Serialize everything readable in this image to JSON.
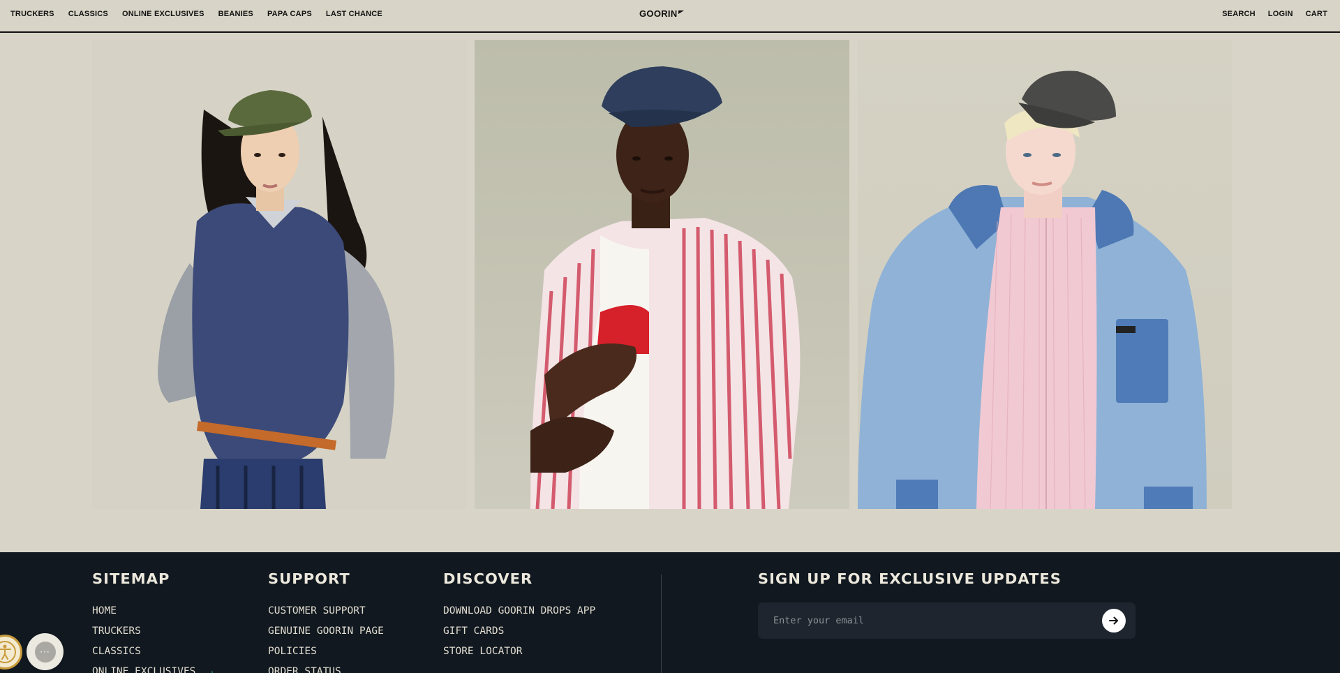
{
  "header": {
    "nav_left": [
      "TRUCKERS",
      "CLASSICS",
      "ONLINE EXCLUSIVES",
      "BEANIES",
      "PAPA CAPS",
      "LAST CHANCE"
    ],
    "logo": "GOORIN",
    "nav_right": [
      "SEARCH",
      "LOGIN",
      "CART"
    ]
  },
  "gallery": {
    "panels": [
      {
        "name": "model-1",
        "cap": "olive flat cap",
        "colors": {
          "cap": "#5b6a3d",
          "shirt": "#9aa0a6",
          "vest": "#3b4a78"
        }
      },
      {
        "name": "model-2",
        "cap": "navy flat cap",
        "colors": {
          "cap": "#2e3e5c",
          "shirt": "#d45b6e",
          "tee": "#f4f1ec"
        }
      },
      {
        "name": "model-3",
        "cap": "charcoal flat cap",
        "colors": {
          "cap": "#4a4a48",
          "shirt": "#f1c9d3",
          "jacket": "#8fb2d6"
        }
      }
    ]
  },
  "footer": {
    "sitemap": {
      "title": "SITEMAP",
      "items": [
        "HOME",
        "TRUCKERS",
        "CLASSICS",
        "ONLINE EXCLUSIVES"
      ]
    },
    "support": {
      "title": "SUPPORT",
      "items": [
        "CUSTOMER SUPPORT",
        "GENUINE GOORIN PAGE",
        "POLICIES",
        "ORDER STATUS"
      ]
    },
    "discover": {
      "title": "DISCOVER",
      "items": [
        "DOWNLOAD GOORIN DROPS APP",
        "GIFT CARDS",
        "STORE LOCATOR"
      ]
    },
    "signup": {
      "title": "SIGN UP FOR EXCLUSIVE UPDATES",
      "placeholder": "Enter your email"
    }
  },
  "widgets": {
    "accessibility": "accessibility-icon",
    "chat": "chat-icon"
  }
}
